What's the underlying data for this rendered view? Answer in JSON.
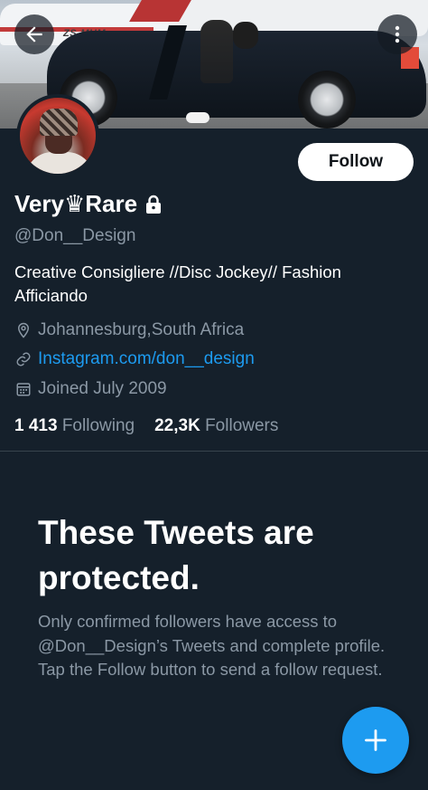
{
  "profile": {
    "display_name": "Very♛Rare",
    "handle": "@Don__Design",
    "bio": "Creative Consigliere //Disc Jockey// Fashion Afficiando",
    "location": "Johannesburg,South Africa",
    "link": "Instagram.com/don__design",
    "joined": "Joined July 2009",
    "banner_registration": "ZS-MUM"
  },
  "actions": {
    "follow_label": "Follow"
  },
  "stats": {
    "following_count": "1 413",
    "following_label": "Following",
    "followers_count": "22,3K",
    "followers_label": "Followers"
  },
  "protected": {
    "title": "These Tweets are protected.",
    "description": "Only confirmed followers have access to @Don__Design’s Tweets and complete profile. Tap the Follow button to send a follow request."
  },
  "icons": {
    "back": "arrow-left-icon",
    "more": "more-vertical-icon",
    "lock": "lock-icon",
    "location": "location-pin-icon",
    "link": "link-icon",
    "calendar": "calendar-icon",
    "compose": "plus-icon"
  },
  "colors": {
    "background": "#15202b",
    "accent": "#1d9bf0",
    "secondary_text": "#8b98a5",
    "divider": "#38444d"
  }
}
